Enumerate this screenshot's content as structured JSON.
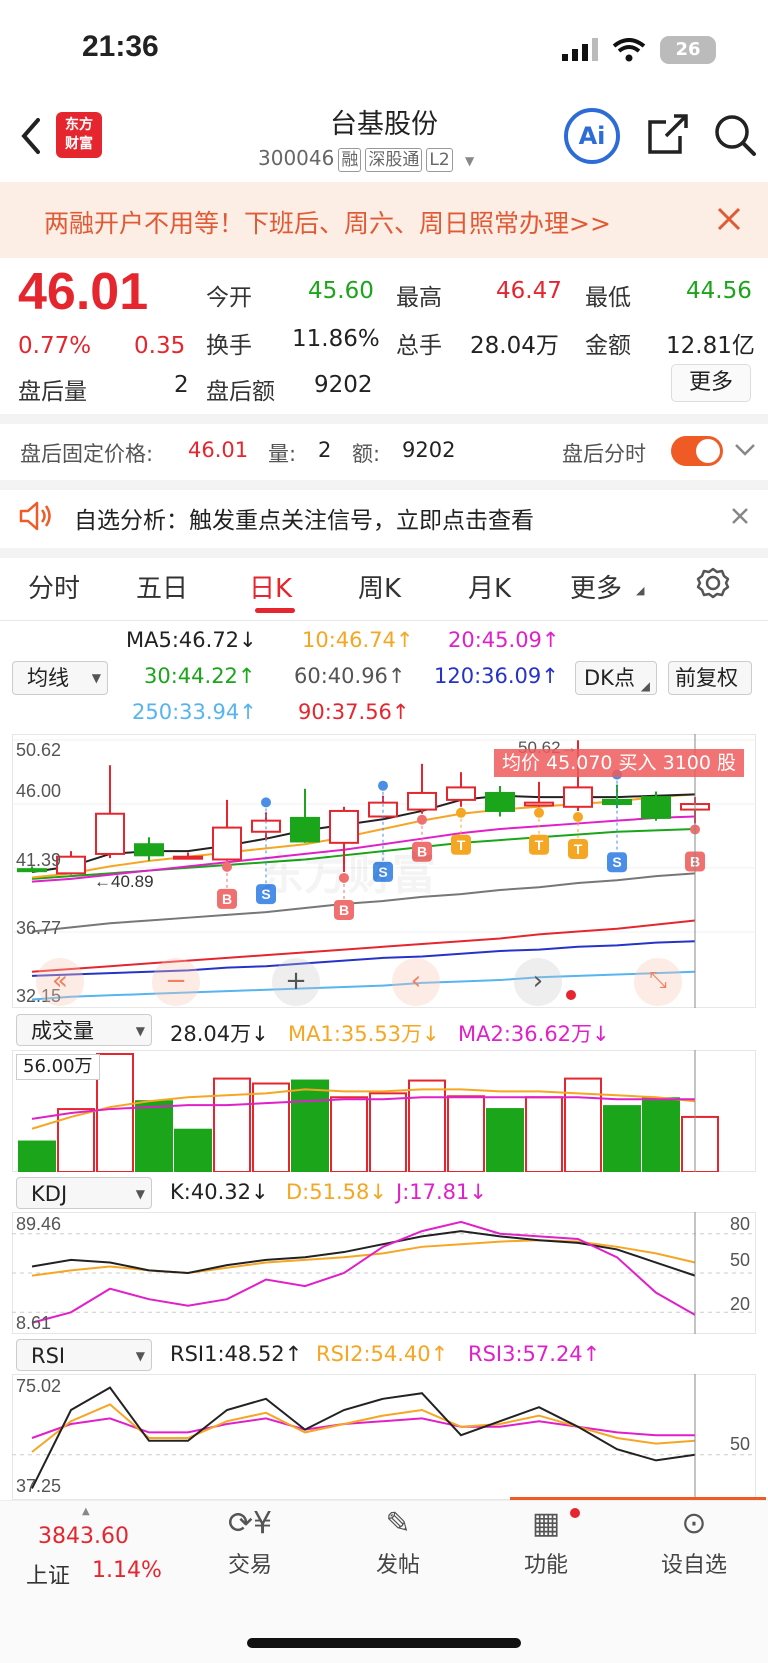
{
  "status": {
    "time": "21:36",
    "battery": "26"
  },
  "header": {
    "title": "台基股份",
    "code": "300046",
    "tags": [
      "融",
      "深股通",
      "L2"
    ],
    "logo_line1": "东方",
    "logo_line2": "财富",
    "ai_label": "Ai"
  },
  "banner": {
    "text": "两融开户不用等！下班后、周六、周日照常办理>>"
  },
  "quote": {
    "price": "46.01",
    "change_pct": "0.77%",
    "change": "0.35",
    "open_label": "今开",
    "open": "45.60",
    "high_label": "最高",
    "high": "46.47",
    "low_label": "最低",
    "low": "44.56",
    "turnover_label": "换手",
    "turnover": "11.86%",
    "volume_label": "总手",
    "volume": "28.04万",
    "amount_label": "金额",
    "amount": "12.81亿",
    "after_vol_label": "盘后量",
    "after_vol": "2",
    "after_amt_label": "盘后额",
    "after_amt": "9202",
    "more": "更多"
  },
  "afterhours": {
    "label": "盘后固定价格:",
    "price": "46.01",
    "vol_label": "量:",
    "vol": "2",
    "amt_label": "额:",
    "amt": "9202",
    "toggle_label": "盘后分时"
  },
  "alert": {
    "text": "自选分析：触发重点关注信号，立即点击查看"
  },
  "tabs": [
    "分时",
    "五日",
    "日K",
    "周K",
    "月K",
    "更多"
  ],
  "ma": {
    "selector": "均线",
    "ma5": "MA5:46.72↓",
    "ma10": "10:46.74↑",
    "ma20": "20:45.09↑",
    "ma30": "30:44.22↑",
    "ma60": "60:40.96↑",
    "ma120": "120:36.09↑",
    "ma250": "250:33.94↑",
    "ma90": "90:37.56↑",
    "dk": "DK点",
    "adjust": "前复权"
  },
  "kchart": {
    "axis": [
      "50.62",
      "46.00",
      "41.39",
      "36.77",
      "32.15"
    ],
    "max_label": "50.62→",
    "min_label": "←40.89",
    "avg_box": "均价 45.070 买入 3100 股",
    "watermark": "东方财富"
  },
  "volume": {
    "selector": "成交量",
    "current": "28.04万↓",
    "ma1": "MA1:35.53万↓",
    "ma2": "MA2:36.62万↓",
    "axis_max": "56.00万"
  },
  "kdj": {
    "selector": "KDJ",
    "k": "K:40.32↓",
    "d": "D:51.58↓",
    "j": "J:17.81↓",
    "top": "89.46",
    "bottom": "8.61",
    "r80": "80",
    "r50": "50",
    "r20": "20"
  },
  "rsi": {
    "selector": "RSI",
    "rsi1": "RSI1:48.52↑",
    "rsi2": "RSI2:54.40↑",
    "rsi3": "RSI3:57.24↑",
    "top": "75.02",
    "bottom": "37.25",
    "r50": "50"
  },
  "bottom": {
    "index_value": "3843.60",
    "index_name": "上证",
    "index_pct": "1.14%",
    "trade": "交易",
    "post": "发帖",
    "func": "功能",
    "watch": "设自选"
  },
  "chart_data": {
    "type": "candlestick",
    "candles": [
      {
        "o": 41.3,
        "c": 41.3,
        "h": 41.5,
        "l": 41.1,
        "up": false
      },
      {
        "o": 41.0,
        "c": 42.2,
        "h": 42.6,
        "l": 40.9,
        "up": true
      },
      {
        "o": 42.4,
        "c": 45.3,
        "h": 48.8,
        "l": 42.1,
        "up": true
      },
      {
        "o": 43.1,
        "c": 42.3,
        "h": 43.6,
        "l": 41.9,
        "up": false
      },
      {
        "o": 42.2,
        "c": 42.2,
        "h": 42.5,
        "l": 42.0,
        "up": true
      },
      {
        "o": 42.0,
        "c": 44.3,
        "h": 46.3,
        "l": 41.9,
        "up": true
      },
      {
        "o": 44.0,
        "c": 44.8,
        "h": 45.4,
        "l": 43.4,
        "up": true
      },
      {
        "o": 45.0,
        "c": 43.3,
        "h": 47.1,
        "l": 43.2,
        "up": false
      },
      {
        "o": 43.2,
        "c": 45.5,
        "h": 45.8,
        "l": 41.1,
        "up": true
      },
      {
        "o": 45.1,
        "c": 46.1,
        "h": 46.6,
        "l": 45.0,
        "up": true
      },
      {
        "o": 45.6,
        "c": 46.8,
        "h": 48.9,
        "l": 45.3,
        "up": true
      },
      {
        "o": 46.3,
        "c": 47.2,
        "h": 48.3,
        "l": 45.8,
        "up": true
      },
      {
        "o": 46.8,
        "c": 45.5,
        "h": 47.3,
        "l": 45.1,
        "up": false
      },
      {
        "o": 45.9,
        "c": 46.1,
        "h": 47.6,
        "l": 45.8,
        "up": true
      },
      {
        "o": 45.8,
        "c": 47.2,
        "h": 50.6,
        "l": 45.5,
        "up": true
      },
      {
        "o": 46.3,
        "c": 46.0,
        "h": 47.4,
        "l": 45.7,
        "up": false
      },
      {
        "o": 46.5,
        "c": 45.0,
        "h": 46.9,
        "l": 44.8,
        "up": false
      },
      {
        "o": 45.6,
        "c": 46.0,
        "h": 46.5,
        "l": 44.6,
        "up": true
      }
    ],
    "volumes": [
      {
        "v": 15.5,
        "up": false
      },
      {
        "v": 32.0,
        "up": true
      },
      {
        "v": 60.0,
        "up": true
      },
      {
        "v": 36.0,
        "up": false
      },
      {
        "v": 21.5,
        "up": false
      },
      {
        "v": 47.5,
        "up": true
      },
      {
        "v": 45.0,
        "up": true
      },
      {
        "v": 46.5,
        "up": false
      },
      {
        "v": 38.0,
        "up": true
      },
      {
        "v": 40.0,
        "up": true
      },
      {
        "v": 46.5,
        "up": true
      },
      {
        "v": 38.5,
        "up": true
      },
      {
        "v": 32.0,
        "up": false
      },
      {
        "v": 38.0,
        "up": true
      },
      {
        "v": 47.5,
        "up": true
      },
      {
        "v": 33.5,
        "up": false
      },
      {
        "v": 37.5,
        "up": false
      },
      {
        "v": 28.0,
        "up": true
      }
    ],
    "ma5": [
      41.1,
      41.5,
      42.4,
      42.6,
      42.6,
      43.0,
      43.5,
      44.1,
      44.5,
      44.9,
      45.5,
      46.3,
      46.6,
      46.5,
      46.5,
      46.5,
      46.6,
      46.7
    ],
    "ma10": [
      40.7,
      41.0,
      41.5,
      41.9,
      42.2,
      42.5,
      42.8,
      43.1,
      43.6,
      44.2,
      44.8,
      45.3,
      45.6,
      45.8,
      46.0,
      46.2,
      46.5,
      46.7
    ],
    "ma20": [
      40.4,
      40.6,
      40.9,
      41.2,
      41.5,
      41.8,
      42.1,
      42.4,
      42.7,
      43.1,
      43.5,
      43.9,
      44.2,
      44.4,
      44.6,
      44.8,
      45.0,
      45.1
    ],
    "ma30": [
      40.6,
      40.8,
      41.0,
      41.2,
      41.4,
      41.6,
      41.8,
      42.0,
      42.3,
      42.6,
      42.9,
      43.2,
      43.4,
      43.6,
      43.8,
      44.0,
      44.1,
      44.2
    ],
    "ma60": [
      36.8,
      37.1,
      37.4,
      37.6,
      37.8,
      38.0,
      38.2,
      38.5,
      38.8,
      39.0,
      39.3,
      39.5,
      39.8,
      40.0,
      40.3,
      40.5,
      40.8,
      41.0
    ],
    "ma90": [
      33.9,
      34.1,
      34.3,
      34.5,
      34.7,
      34.9,
      35.1,
      35.3,
      35.5,
      35.7,
      35.9,
      36.1,
      36.3,
      36.6,
      36.8,
      37.0,
      37.3,
      37.6
    ],
    "ma120": [
      33.6,
      33.7,
      33.8,
      33.9,
      34.0,
      34.2,
      34.3,
      34.5,
      34.7,
      34.9,
      35.0,
      35.2,
      35.4,
      35.5,
      35.7,
      35.8,
      36.0,
      36.1
    ],
    "ma250": [
      31.9,
      32.1,
      32.2,
      32.3,
      32.4,
      32.5,
      32.6,
      32.7,
      32.8,
      32.9,
      33.1,
      33.2,
      33.3,
      33.5,
      33.6,
      33.7,
      33.8,
      33.9
    ],
    "signals": [
      {
        "i": 5,
        "t": "B"
      },
      {
        "i": 6,
        "t": "S"
      },
      {
        "i": 8,
        "t": "B"
      },
      {
        "i": 9,
        "t": "S"
      },
      {
        "i": 10,
        "t": "B"
      },
      {
        "i": 11,
        "t": "T"
      },
      {
        "i": 13,
        "t": "T"
      },
      {
        "i": 14,
        "t": "T"
      },
      {
        "i": 15,
        "t": "S"
      },
      {
        "i": 17,
        "t": "B"
      }
    ],
    "kdj_k": [
      55,
      60,
      58,
      52,
      50,
      56,
      60,
      62,
      66,
      72,
      78,
      82,
      78,
      75,
      73,
      68,
      58,
      48
    ],
    "kdj_d": [
      48,
      52,
      55,
      52,
      50,
      54,
      58,
      60,
      62,
      65,
      70,
      72,
      74,
      75,
      74,
      70,
      65,
      58
    ],
    "kdj_j": [
      12,
      20,
      38,
      30,
      25,
      30,
      45,
      40,
      50,
      70,
      82,
      89,
      80,
      78,
      76,
      62,
      35,
      18
    ],
    "rsi1": [
      38,
      66,
      74,
      55,
      55,
      66,
      70,
      59,
      66,
      70,
      72,
      57,
      62,
      67,
      60,
      52,
      48,
      50
    ],
    "rsi2": [
      51,
      62,
      68,
      56,
      56,
      62,
      65,
      58,
      61,
      64,
      66,
      60,
      61,
      64,
      60,
      56,
      54,
      55
    ],
    "rsi3": [
      56,
      61,
      63,
      58,
      58,
      61,
      63,
      59,
      61,
      62,
      63,
      60,
      60,
      62,
      60,
      58,
      57,
      57
    ]
  }
}
